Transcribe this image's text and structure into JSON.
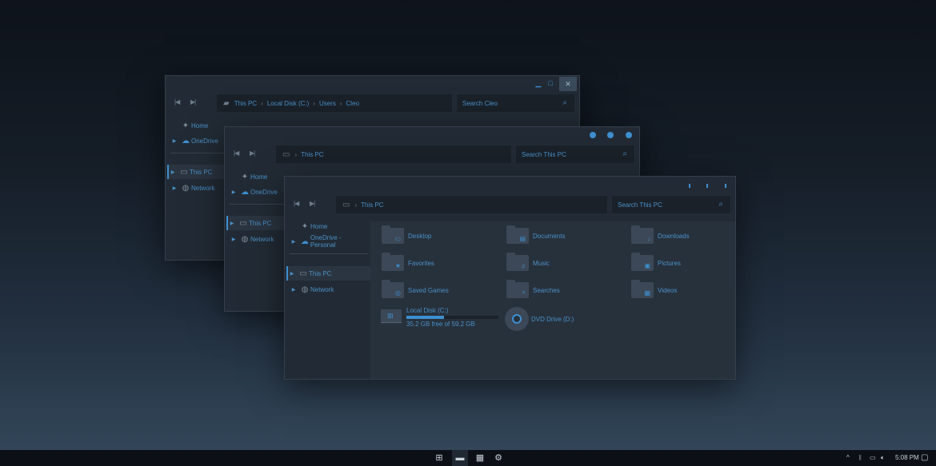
{
  "windows": {
    "back": {
      "address": {
        "segments": [
          "This PC",
          "Local Disk (C:)",
          "Users",
          "Cleo"
        ]
      },
      "search_placeholder": "Search Cleo",
      "sidebar": {
        "home": "Home",
        "onedrive": "OneDrive",
        "this_pc": "This PC",
        "network": "Network"
      }
    },
    "middle": {
      "address": {
        "segments": [
          "This PC"
        ]
      },
      "search_placeholder": "Search This PC",
      "sidebar": {
        "home": "Home",
        "onedrive": "OneDrive",
        "this_pc": "This PC",
        "network": "Network"
      }
    },
    "front": {
      "address": {
        "segments": [
          "This PC"
        ]
      },
      "search_placeholder": "Search This PC",
      "sidebar": {
        "home": "Home",
        "onedrive": "OneDrive - Personal",
        "this_pc": "This PC",
        "network": "Network"
      },
      "folders": [
        {
          "label": "Desktop",
          "icon": "desktop-icon",
          "glyph": "▭"
        },
        {
          "label": "Documents",
          "icon": "document-icon",
          "glyph": "▤"
        },
        {
          "label": "Downloads",
          "icon": "download-icon",
          "glyph": "↓"
        },
        {
          "label": "Favorites",
          "icon": "star-icon",
          "glyph": "★"
        },
        {
          "label": "Music",
          "icon": "music-icon",
          "glyph": "♫"
        },
        {
          "label": "Pictures",
          "icon": "picture-icon",
          "glyph": "▣"
        },
        {
          "label": "Saved Games",
          "icon": "gamepad-icon",
          "glyph": "◎"
        },
        {
          "label": "Searches",
          "icon": "search-icon",
          "glyph": "⌕"
        },
        {
          "label": "Videos",
          "icon": "video-icon",
          "glyph": "▦"
        }
      ],
      "drives": {
        "local": {
          "label": "Local Disk (C:)",
          "space": "35.2 GB free of 59.2 GB",
          "used_fraction": 0.41
        },
        "dvd": {
          "label": "DVD Drive (D:)"
        }
      }
    }
  },
  "taskbar": {
    "time": "5:08 PM",
    "icons": [
      "start-icon",
      "file-explorer-icon",
      "store-icon",
      "settings-icon"
    ]
  },
  "colors": {
    "accent": "#3d8fd0",
    "window_bg": "#222b35",
    "content_bg": "#27313c"
  }
}
